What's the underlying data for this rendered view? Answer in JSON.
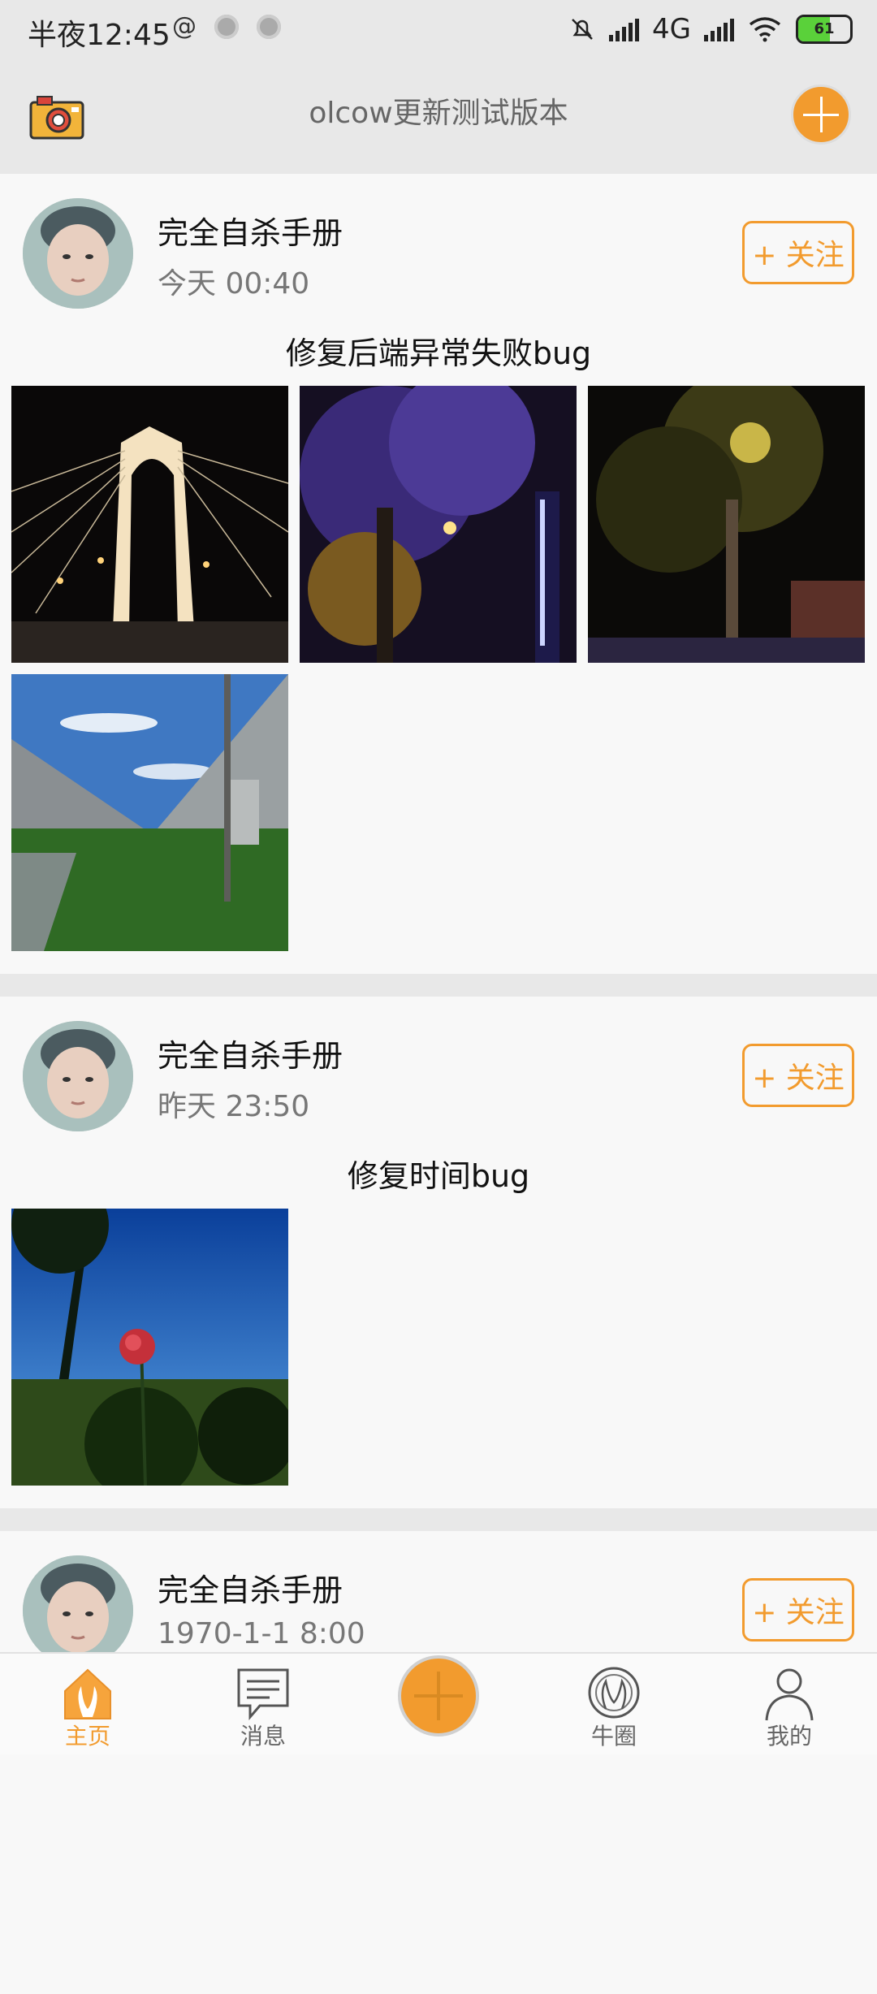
{
  "status_bar": {
    "time": "半夜12:45",
    "network": "4G",
    "battery": "61",
    "battery_level": 0.61
  },
  "header": {
    "title": "olcow更新测试版本",
    "camera_icon": "camera-icon",
    "add_icon": "plus-icon"
  },
  "posts": [
    {
      "author": "完全自杀手册",
      "time": "今天 00:40",
      "follow_label": "+ 关注",
      "text": "修复后端异常失败bug",
      "photos": [
        "bridge-night-photo",
        "tree-night-photo",
        "street-night-photo",
        "railway-viaduct-photo"
      ]
    },
    {
      "author": "完全自杀手册",
      "time": "昨天 23:50",
      "follow_label": "+ 关注",
      "text": "修复时间bug",
      "photos": [
        "flower-sky-photo"
      ]
    },
    {
      "author": "完全自杀手册",
      "time": "1970-1-1 8:00",
      "follow_label": "+ 关注",
      "text": "",
      "photos": []
    }
  ],
  "nav": {
    "home": "主页",
    "messages": "消息",
    "circle": "牛圈",
    "mine": "我的"
  },
  "colors": {
    "accent": "#f29b2e",
    "background": "#e8e8e8",
    "card": "#f8f8f8"
  }
}
